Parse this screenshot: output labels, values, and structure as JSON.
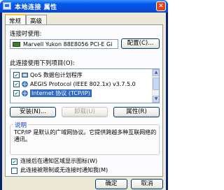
{
  "window": {
    "title": "本地连接 属性",
    "close_glyph": "✕"
  },
  "tabs": [
    "常规",
    "高级"
  ],
  "connect_using": {
    "label": "连接时使用:",
    "adapter": "Marvell Yukon 88E8056 PCI-E Gi",
    "configure_button": "配置(C)..."
  },
  "items_section": {
    "label": "此连接使用下列项目(O):",
    "items": [
      {
        "label": "QoS 数据包计划程序",
        "checked": true,
        "check_glyph": "✔",
        "selected": false,
        "icon": "qos-icon"
      },
      {
        "label": "AEGIS Protocol (IEEE 802.1x) v3.7.5.0",
        "checked": true,
        "check_glyph": "✔",
        "selected": false,
        "icon": "protocol-icon"
      },
      {
        "label": "Internet 协议 (TCP/IP)",
        "checked": true,
        "check_glyph": "✔",
        "selected": true,
        "icon": "protocol-icon"
      }
    ]
  },
  "buttons": {
    "install": "安装(N)...",
    "uninstall": "卸载(U)",
    "properties": "属性(R)",
    "ok": "确定",
    "cancel": "取消"
  },
  "description": {
    "title": "说明",
    "text": "TCP/IP 是默认的广域网协议。它提供跨越多种互联网络的通讯。"
  },
  "options": [
    {
      "label": "连接后在通知区域显示图标(W)",
      "checked": true,
      "check_glyph": "✔"
    },
    {
      "label": "此连接被限制或无连接时通知我(M)",
      "checked": false,
      "check_glyph": ""
    }
  ],
  "scrollbar": {
    "up_glyph": "▲",
    "down_glyph": "▼"
  },
  "colors": {
    "titlebar": "#0058ee",
    "selection": "#316ac5",
    "dialog_bg": "#ece9d8",
    "close_button": "#e0461e"
  }
}
